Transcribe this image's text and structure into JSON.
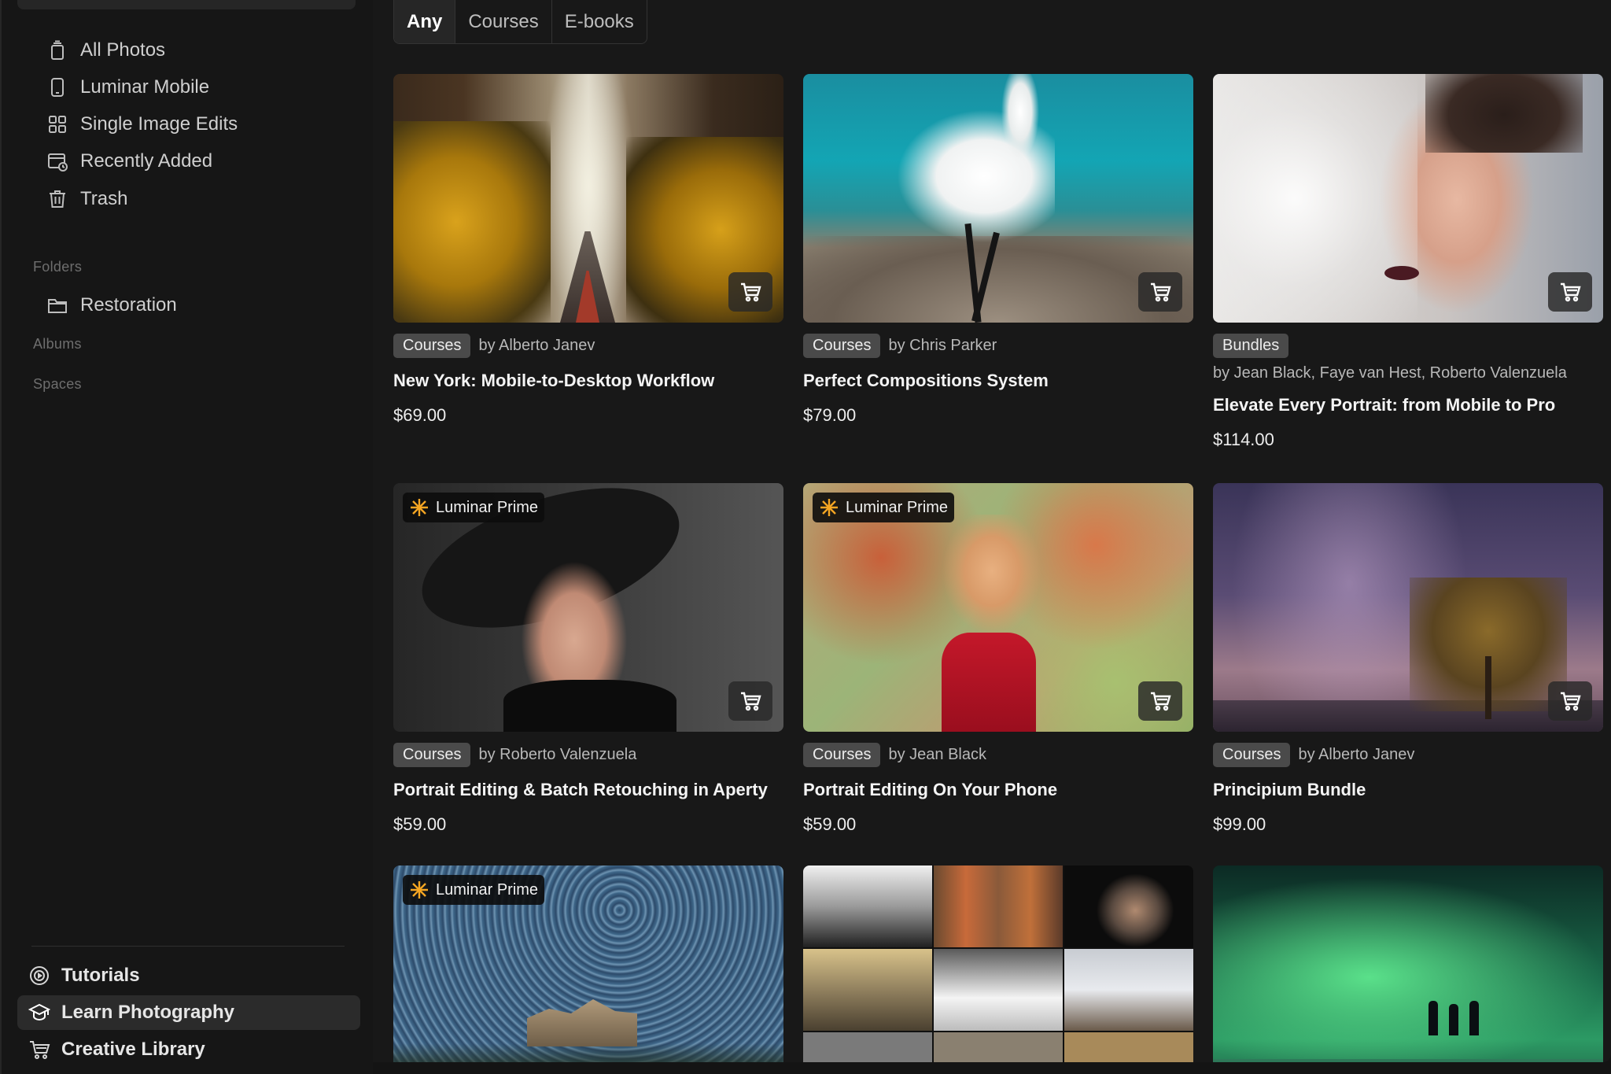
{
  "sidebar": {
    "items": [
      {
        "label": "All Photos"
      },
      {
        "label": "Luminar Mobile"
      },
      {
        "label": "Single Image Edits"
      },
      {
        "label": "Recently Added"
      },
      {
        "label": "Trash"
      }
    ],
    "folders_label": "Folders",
    "folders": [
      {
        "label": "Restoration"
      }
    ],
    "albums_label": "Albums",
    "spaces_label": "Spaces",
    "bottom": [
      {
        "label": "Tutorials"
      },
      {
        "label": "Learn Photography",
        "active": true
      },
      {
        "label": "Creative Library"
      }
    ]
  },
  "tabs": [
    {
      "label": "Any",
      "selected": true
    },
    {
      "label": "Courses"
    },
    {
      "label": "E-books"
    }
  ],
  "badge_label": "Luminar Prime",
  "colors": {
    "prime_accent": "#f5a623",
    "tag_bg": "#4a4a4a",
    "sidebar_bg": "#161616",
    "active_bg": "#2b2b2b"
  },
  "products": [
    {
      "tag": "Courses",
      "author": "by Alberto Janev",
      "title": "New York: Mobile-to-Desktop Workflow",
      "price": "$69.00",
      "prime": false
    },
    {
      "tag": "Courses",
      "author": "by Chris Parker",
      "title": "Perfect Compositions System",
      "price": "$79.00",
      "prime": false
    },
    {
      "tag": "Bundles",
      "author": "by Jean Black, Faye van Hest, Roberto Valenzuela",
      "title": "Elevate Every Portrait: from Mobile to Pro",
      "price": "$114.00",
      "prime": false
    },
    {
      "tag": "Courses",
      "author": "by Roberto Valenzuela",
      "title": "Portrait Editing & Batch Retouching in Aperty",
      "price": "$59.00",
      "prime": true
    },
    {
      "tag": "Courses",
      "author": "by Jean Black",
      "title": "Portrait Editing On Your Phone",
      "price": "$59.00",
      "prime": true
    },
    {
      "tag": "Courses",
      "author": "by Alberto Janev",
      "title": "Principium Bundle",
      "price": "$99.00",
      "prime": false
    },
    {
      "prime": true
    },
    {
      "prime": false
    },
    {
      "prime": false
    }
  ]
}
